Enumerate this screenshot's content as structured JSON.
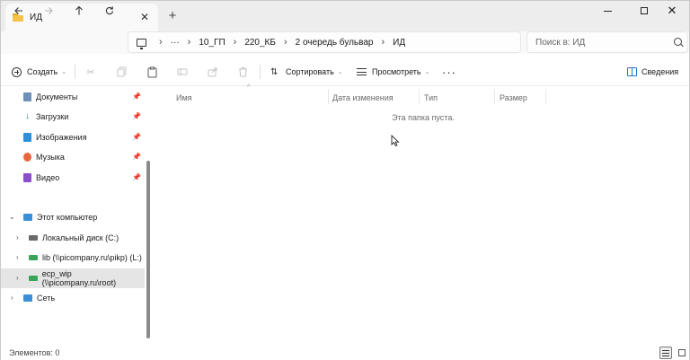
{
  "window": {
    "tab_title": "ИД",
    "new_tab_label": "+",
    "close_tab_label": "✕"
  },
  "address": {
    "ellipsis": "···",
    "crumbs": [
      "10_ГП",
      "220_КБ",
      "2 очередь бульвар",
      "ИД"
    ]
  },
  "search": {
    "placeholder": "Поиск в: ИД"
  },
  "commandbar": {
    "create_label": "Создать",
    "sort_label": "Сортировать",
    "view_label": "Просмотреть",
    "more_label": "···",
    "details_label": "Сведения"
  },
  "sidebar": {
    "quick_access": [
      {
        "label": "Документы",
        "icon": "documents-icon",
        "color": "#6f8fb8"
      },
      {
        "label": "Загрузки",
        "icon": "downloads-icon",
        "color": "#1f8f5a"
      },
      {
        "label": "Изображения",
        "icon": "pictures-icon",
        "color": "#2d8fd8"
      },
      {
        "label": "Музыка",
        "icon": "music-icon",
        "color": "#e8663d"
      },
      {
        "label": "Видео",
        "icon": "video-icon",
        "color": "#8b4fc9"
      }
    ],
    "this_pc": "Этот компьютер",
    "drives": [
      {
        "label": "Локальный диск (C:)"
      },
      {
        "label": "lib (\\\\picompany.ru\\pikp) (L:)"
      },
      {
        "label": "ecp_wip (\\\\picompany.ru\\root)"
      }
    ],
    "network": "Сеть"
  },
  "columns": {
    "name": "Имя",
    "date": "Дата изменения",
    "type": "Тип",
    "size": "Размер"
  },
  "main": {
    "empty_message": "Эта папка пуста."
  },
  "status": {
    "item_count": "Элементов: 0"
  },
  "colors": {
    "accent": "#2b6fc6",
    "folder": "#f4c249",
    "selected_row": "#e5e5e5"
  }
}
